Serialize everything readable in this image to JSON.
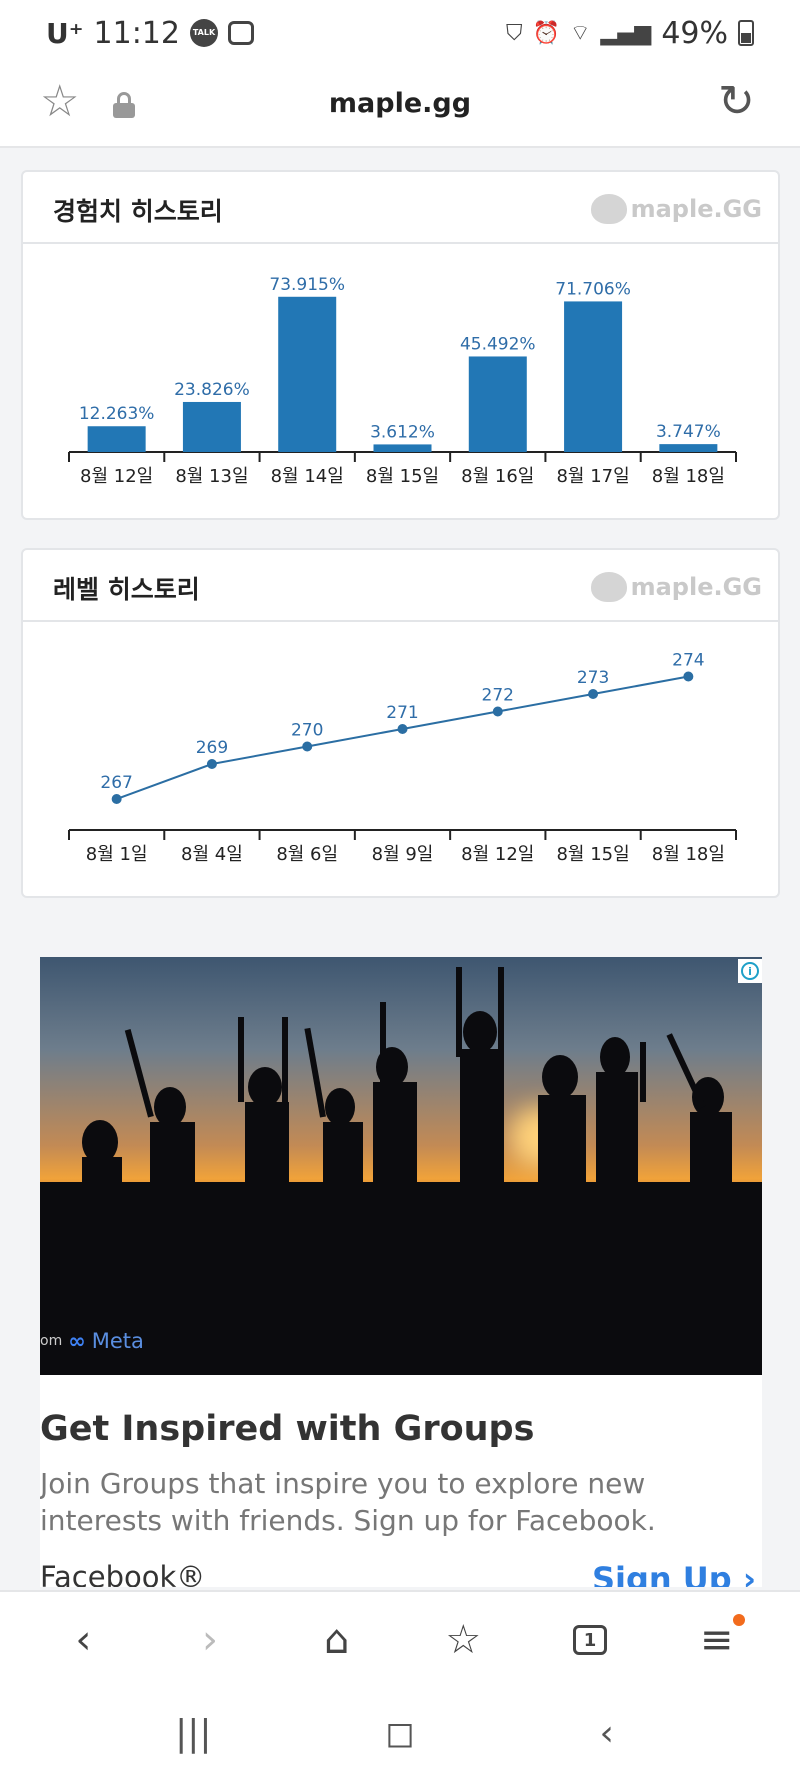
{
  "status_bar": {
    "carrier": "U⁺",
    "time": "11:12",
    "talk_badge": "TALK",
    "battery": "49%"
  },
  "url_bar": {
    "url": "maple.gg",
    "icons": [
      "star-icon",
      "lock-icon",
      "reload-icon"
    ]
  },
  "exp_card": {
    "title": "경험치 히스토리",
    "watermark": "maple.GG",
    "chart_data": {
      "type": "bar",
      "categories": [
        "8월 12일",
        "8월 13일",
        "8월 14일",
        "8월 15일",
        "8월 16일",
        "8월 17일",
        "8월 18일"
      ],
      "values": [
        12.263,
        23.826,
        73.915,
        3.612,
        45.492,
        71.706,
        3.747
      ],
      "labels": [
        "12.263%",
        "23.826%",
        "73.915%",
        "3.612%",
        "45.492%",
        "71.706%",
        "3.747%"
      ],
      "ylim": [
        0,
        100
      ],
      "color": "#2277b5"
    }
  },
  "level_card": {
    "title": "레벨 히스토리",
    "watermark": "maple.GG",
    "chart_data": {
      "type": "line",
      "categories": [
        "8월 1일",
        "8월 4일",
        "8월 6일",
        "8월 9일",
        "8월 12일",
        "8월 15일",
        "8월 18일"
      ],
      "values": [
        267,
        269,
        270,
        271,
        272,
        273,
        274
      ],
      "labels": [
        "267",
        "269",
        "270",
        "271",
        "272",
        "273",
        "274"
      ],
      "ylim": [
        266,
        275
      ],
      "color": "#2b6ea3"
    }
  },
  "ad": {
    "info_icon": "i",
    "meta_prefix": "om",
    "meta_mark": "∞",
    "meta_label": "Meta",
    "title": "Get Inspired with Groups",
    "description": "Join Groups that inspire you to explore new interests with friends. Sign up for Facebook.",
    "brand": "Facebook®",
    "cta": "Sign Up",
    "cta_arrow": "›"
  },
  "toolbar": {
    "back": "‹",
    "forward": "›",
    "home": "⌂",
    "bookmarks": "☆",
    "tabs": "1",
    "menu": "≡"
  },
  "nav_bar": {
    "recents": "|||",
    "home": "◻",
    "back": "‹"
  }
}
